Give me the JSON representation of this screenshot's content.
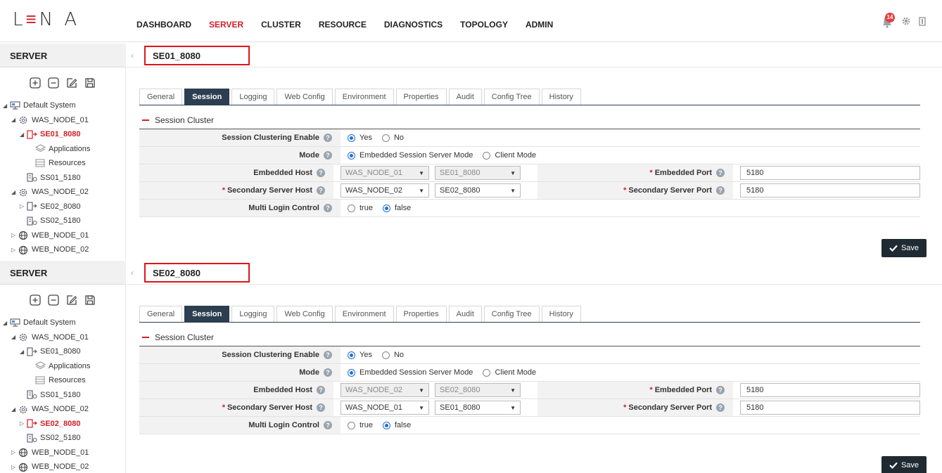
{
  "app": {
    "logo_letters": "L",
    "logo_rest": "N A",
    "notifications": "14"
  },
  "nav": [
    "DASHBOARD",
    "SERVER",
    "CLUSTER",
    "RESOURCE",
    "DIAGNOSTICS",
    "TOPOLOGY",
    "ADMIN"
  ],
  "nav_active": "SERVER",
  "panels": [
    {
      "side_title": "SERVER",
      "title": "SE01_8080",
      "tree": [
        {
          "label": "Default System",
          "level": 0,
          "icon": "system-icon",
          "tri": "◢"
        },
        {
          "label": "WAS_NODE_01",
          "level": 1,
          "icon": "node-icon",
          "tri": "◢"
        },
        {
          "label": "SE01_8080",
          "level": 2,
          "icon": "server-icon",
          "tri": "◢",
          "selected": true
        },
        {
          "label": "Applications",
          "level": 3,
          "icon": "applications-icon",
          "tri": ""
        },
        {
          "label": "Resources",
          "level": 3,
          "icon": "resources-icon",
          "tri": ""
        },
        {
          "label": "SS01_5180",
          "level": 2,
          "icon": "session-server-icon",
          "tri": ""
        },
        {
          "label": "WAS_NODE_02",
          "level": 1,
          "icon": "node-icon",
          "tri": "◢"
        },
        {
          "label": "SE02_8080",
          "level": 2,
          "icon": "server-icon",
          "tri": "▷"
        },
        {
          "label": "SS02_5180",
          "level": 2,
          "icon": "session-server-icon",
          "tri": ""
        },
        {
          "label": "WEB_NODE_01",
          "level": 1,
          "icon": "web-icon",
          "tri": "▷"
        },
        {
          "label": "WEB_NODE_02",
          "level": 1,
          "icon": "web-icon",
          "tri": "▷"
        }
      ],
      "tabs": [
        "General",
        "Session",
        "Logging",
        "Web Config",
        "Environment",
        "Properties",
        "Audit",
        "Config Tree",
        "History"
      ],
      "active_tab": "Session",
      "section": "Session Cluster",
      "form": {
        "clustering_label": "Session Clustering Enable",
        "clustering_yes": "Yes",
        "clustering_no": "No",
        "mode_label": "Mode",
        "mode_embedded": "Embedded Session Server Mode",
        "mode_client": "Client Mode",
        "emb_host_label": "Embedded Host",
        "emb_host_node": "WAS_NODE_01",
        "emb_host_server": "SE01_8080",
        "emb_port_label": "Embedded Port",
        "emb_port": "5180",
        "sec_host_label": "Secondary Server Host",
        "sec_host_node": "WAS_NODE_02",
        "sec_host_server": "SE02_8080",
        "sec_port_label": "Secondary Server Port",
        "sec_port": "5180",
        "multi_label": "Multi Login Control",
        "multi_true": "true",
        "multi_false": "false"
      },
      "save": "Save"
    },
    {
      "side_title": "SERVER",
      "title": "SE02_8080",
      "tree": [
        {
          "label": "Default System",
          "level": 0,
          "icon": "system-icon",
          "tri": "◢"
        },
        {
          "label": "WAS_NODE_01",
          "level": 1,
          "icon": "node-icon",
          "tri": "◢"
        },
        {
          "label": "SE01_8080",
          "level": 2,
          "icon": "server-icon",
          "tri": "◢"
        },
        {
          "label": "Applications",
          "level": 3,
          "icon": "applications-icon",
          "tri": ""
        },
        {
          "label": "Resources",
          "level": 3,
          "icon": "resources-icon",
          "tri": ""
        },
        {
          "label": "SS01_5180",
          "level": 2,
          "icon": "session-server-icon",
          "tri": ""
        },
        {
          "label": "WAS_NODE_02",
          "level": 1,
          "icon": "node-icon",
          "tri": "◢"
        },
        {
          "label": "SE02_8080",
          "level": 2,
          "icon": "server-icon",
          "tri": "▷",
          "selected": true
        },
        {
          "label": "SS02_5180",
          "level": 2,
          "icon": "session-server-icon",
          "tri": ""
        },
        {
          "label": "WEB_NODE_01",
          "level": 1,
          "icon": "web-icon",
          "tri": "▷"
        },
        {
          "label": "WEB_NODE_02",
          "level": 1,
          "icon": "web-icon",
          "tri": "▷"
        }
      ],
      "tabs": [
        "General",
        "Session",
        "Logging",
        "Web Config",
        "Environment",
        "Properties",
        "Audit",
        "Config Tree",
        "History"
      ],
      "active_tab": "Session",
      "section": "Session Cluster",
      "form": {
        "clustering_label": "Session Clustering Enable",
        "clustering_yes": "Yes",
        "clustering_no": "No",
        "mode_label": "Mode",
        "mode_embedded": "Embedded Session Server Mode",
        "mode_client": "Client Mode",
        "emb_host_label": "Embedded Host",
        "emb_host_node": "WAS_NODE_02",
        "emb_host_server": "SE02_8080",
        "emb_port_label": "Embedded Port",
        "emb_port": "5180",
        "sec_host_label": "Secondary Server Host",
        "sec_host_node": "WAS_NODE_01",
        "sec_host_server": "SE01_8080",
        "sec_port_label": "Secondary Server Port",
        "sec_port": "5180",
        "multi_label": "Multi Login Control",
        "multi_true": "true",
        "multi_false": "false"
      },
      "save": "Save"
    }
  ],
  "colors": {
    "accent": "#d12027",
    "tab_active": "#2c3e50",
    "radio": "#1d6fd6",
    "highlight_box": "#e0141c"
  }
}
